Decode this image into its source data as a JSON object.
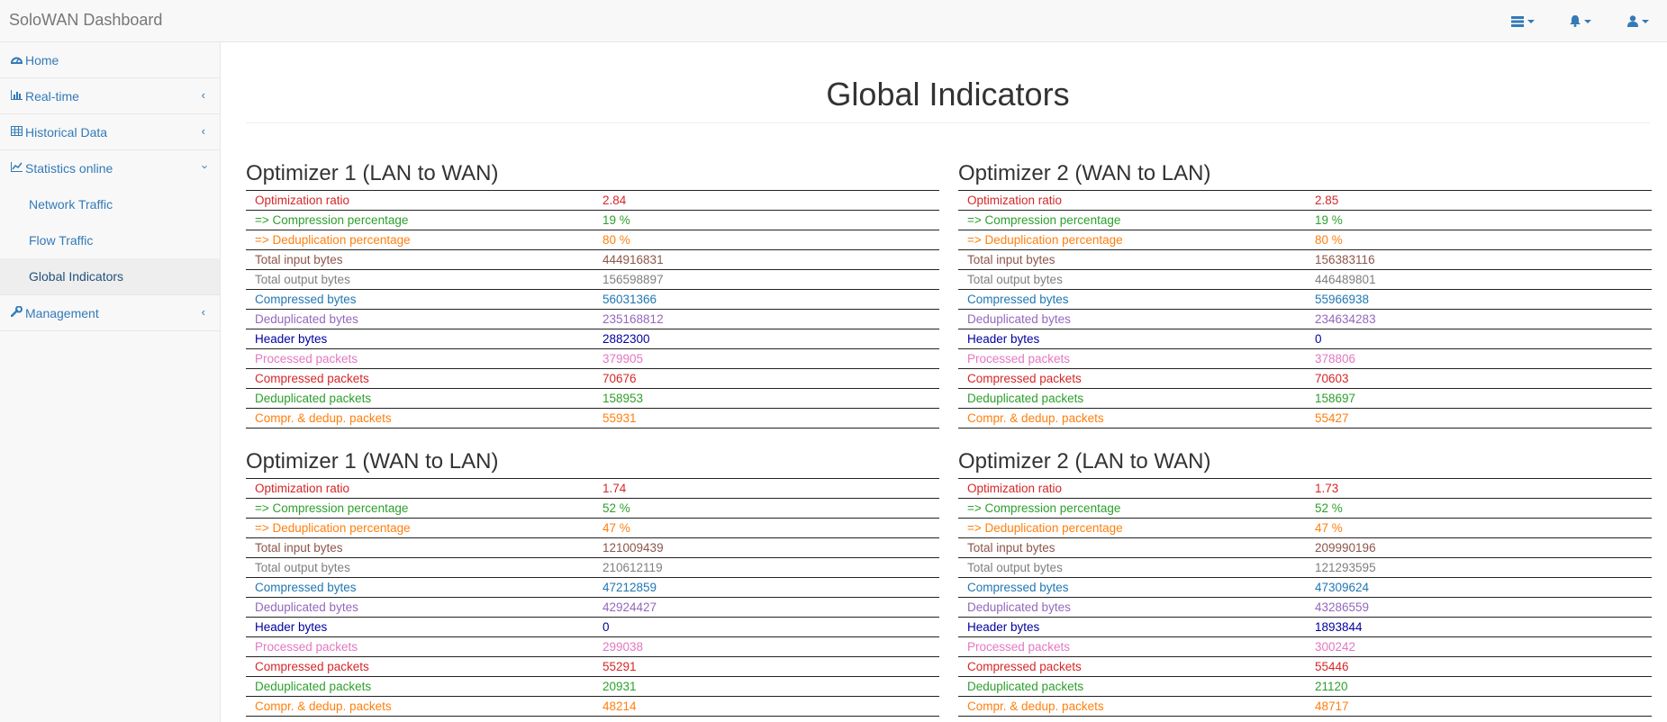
{
  "app": {
    "brand": "SoloWAN Dashboard"
  },
  "topbar": {
    "icons": [
      "tasks-icon",
      "bell-icon",
      "user-icon"
    ]
  },
  "sidebar": {
    "items": [
      {
        "label": "Home",
        "icon": "dashboard-icon"
      },
      {
        "label": "Real-time",
        "icon": "bar-chart-icon"
      },
      {
        "label": "Historical Data",
        "icon": "table-icon"
      },
      {
        "label": "Statistics online",
        "icon": "line-chart-icon"
      },
      {
        "label": "Management",
        "icon": "wrench-icon"
      }
    ],
    "sub_items": [
      {
        "label": "Network Traffic"
      },
      {
        "label": "Flow Traffic"
      },
      {
        "label": "Global Indicators",
        "active": true
      }
    ]
  },
  "main": {
    "title": "Global Indicators",
    "row_labels": [
      "Optimization ratio",
      "=> Compression percentage",
      "=> Deduplication percentage",
      "Total input bytes",
      "Total output bytes",
      "Compressed bytes",
      "Deduplicated bytes",
      "Header bytes",
      "Processed packets",
      "Compressed packets",
      "Deduplicated packets",
      "Compr. & dedup. packets"
    ],
    "panels": [
      {
        "title": "Optimizer 1 (LAN to WAN)",
        "values": [
          "2.84",
          "19 %",
          "80 %",
          "444916831",
          "156598897",
          "56031366",
          "235168812",
          "2882300",
          "379905",
          "70676",
          "158953",
          "55931"
        ]
      },
      {
        "title": "Optimizer 2 (WAN to LAN)",
        "values": [
          "2.85",
          "19 %",
          "80 %",
          "156383116",
          "446489801",
          "55966938",
          "234634283",
          "0",
          "378806",
          "70603",
          "158697",
          "55427"
        ]
      },
      {
        "title": "Optimizer 1 (WAN to LAN)",
        "values": [
          "1.74",
          "52 %",
          "47 %",
          "121009439",
          "210612119",
          "47212859",
          "42924427",
          "0",
          "299038",
          "55291",
          "20931",
          "48214"
        ]
      },
      {
        "title": "Optimizer 2 (LAN to WAN)",
        "values": [
          "1.73",
          "52 %",
          "47 %",
          "209990196",
          "121293595",
          "47309624",
          "43286559",
          "1893844",
          "300242",
          "55446",
          "21120",
          "48717"
        ]
      }
    ]
  },
  "colors": {
    "link": "#337ab7",
    "ratio": "#d62728",
    "compression": "#2ca02c",
    "deduplication": "#ff7f0e",
    "input": "#8c564b",
    "output": "#7f7f7f",
    "compressed_bytes": "#1f77b4",
    "deduplicated_bytes": "#9467bd",
    "header": "#0000a0",
    "processed": "#e377c2"
  }
}
